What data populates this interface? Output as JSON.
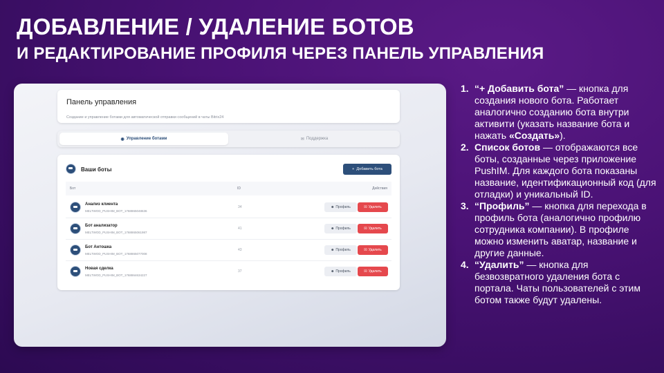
{
  "slide": {
    "title_line1": "ДОБАВЛЕНИЕ / УДАЛЕНИЕ БОТОВ",
    "title_line2": "И РЕДАКТИРОВАНИЕ ПРОФИЛЯ ЧЕРЕЗ ПАНЕЛЬ УПРАВЛЕНИЯ"
  },
  "app": {
    "header": {
      "title": "Панель управления",
      "subtitle": "Создание и управление ботами для автоматической отправки сообщений в чаты Bitrix24"
    },
    "tabs": [
      {
        "icon": "bot-icon",
        "label": "Управление ботами",
        "active": true
      },
      {
        "icon": "support-icon",
        "label": "Поддержка",
        "active": false
      }
    ],
    "bots": {
      "title": "Ваши боты",
      "add_button": "Добавить бота",
      "columns": {
        "bot": "Бот",
        "id": "ID",
        "actions": "Действия"
      },
      "rows": [
        {
          "name": "Анализ клиента",
          "code": "MELTWOD_PUSHIM_BOT_1768865048636",
          "id": "34"
        },
        {
          "name": "Бот анализатор",
          "code": "MELTWOD_PUSHIM_BOT_1768865061987",
          "id": "41"
        },
        {
          "name": "Бот Антошка",
          "code": "MELTWOD_PUSHIM_BOT_1768865077008",
          "id": "43"
        },
        {
          "name": "Новая сделка",
          "code": "MELTWOD_PUSHIM_BOT_1768864634227",
          "id": "37"
        }
      ],
      "profile_button": "Профиль",
      "delete_button": "Удалить"
    }
  },
  "notes": [
    {
      "num": "1.",
      "bold": "“+ Добавить бота”",
      "text1": " — кнопка для создания нового бота. Работает аналогично созданию бота внутри активити (указать название бота и нажать ",
      "bold2": "«Создать»",
      "text2": ")."
    },
    {
      "num": "2.",
      "bold": "Список ботов",
      "text1": " — отображаются все боты, созданные через приложение PushIM. Для каждого бота показаны название, идентификационный код (для отладки) и уникальный ID."
    },
    {
      "num": "3.",
      "bold": "“Профиль”",
      "text1": " — кнопка для перехода в профиль бота (аналогично профилю сотрудника компании). В профиле можно изменить аватар, название и другие данные."
    },
    {
      "num": "4.",
      "bold": "“Удалить”",
      "text1": " — кнопка для безвозвратного удаления бота с портала. Чаты пользователей с этим ботом также будут удалены."
    }
  ],
  "colors": {
    "accent": "#2d4f7a",
    "danger": "#e5484d",
    "background": "#4a1275"
  }
}
